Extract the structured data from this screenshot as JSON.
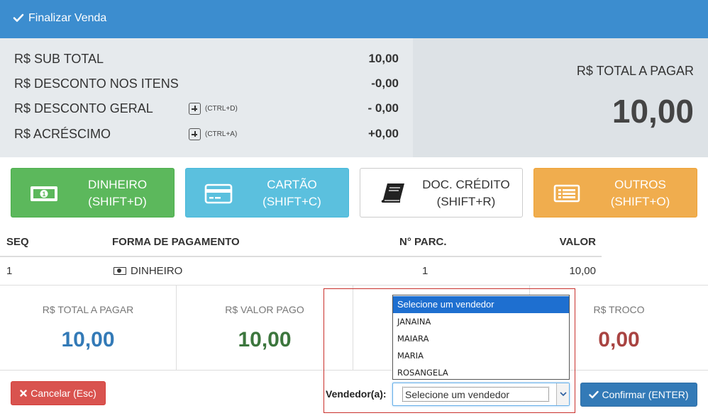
{
  "header": {
    "title": "Finalizar Venda"
  },
  "summary": {
    "rows": [
      {
        "label": "R$ SUB TOTAL",
        "value": "10,00",
        "shortcut": ""
      },
      {
        "label": "R$ DESCONTO NOS ITENS",
        "value": "-0,00",
        "shortcut": ""
      },
      {
        "label": "R$ DESCONTO GERAL",
        "value": "- 0,00",
        "shortcut": "(CTRL+D)"
      },
      {
        "label": "R$ ACRÉSCIMO",
        "value": "+0,00",
        "shortcut": "(CTRL+A)"
      }
    ],
    "total_label": "R$ TOTAL A PAGAR",
    "total_value": "10,00"
  },
  "payment_buttons": [
    {
      "label": "DINHEIRO",
      "shortcut": "(SHIFT+D)",
      "icon": "cash-icon",
      "color": "#5cb85c"
    },
    {
      "label": "CARTÃO",
      "shortcut": "(SHIFT+C)",
      "icon": "credit-card-icon",
      "color": "#5bc0de"
    },
    {
      "label": "DOC. CRÉDITO",
      "shortcut": "(SHIFT+R)",
      "icon": "book-icon",
      "color": "#ffffff"
    },
    {
      "label": "OUTROS",
      "shortcut": "(SHIFT+O)",
      "icon": "list-icon",
      "color": "#f0ad4e"
    }
  ],
  "table": {
    "headers": [
      "SEQ",
      "FORMA DE PAGAMENTO",
      "N° PARC.",
      "VALOR"
    ],
    "rows": [
      {
        "seq": "1",
        "forma": "DINHEIRO",
        "parc": "1",
        "valor": "10,00"
      }
    ]
  },
  "stats": [
    {
      "label": "R$ TOTAL A PAGAR",
      "value": "10,00",
      "color": "#337ab7"
    },
    {
      "label": "R$ VALOR PAGO",
      "value": "10,00",
      "color": "#3c763d"
    },
    {
      "label": "",
      "value": "",
      "color": "#333333"
    },
    {
      "label": "R$ TROCO",
      "value": "0,00",
      "color": "#a94442"
    }
  ],
  "footer": {
    "cancel_label": "Cancelar (Esc)",
    "confirm_label": "Confirmar (ENTER)",
    "vendor_label": "Vendedor(a):",
    "vendor_selected": "Selecione um vendedor",
    "vendor_options": [
      "Selecione um vendedor",
      "JANAINA",
      "MAIARA",
      "MARIA",
      "ROSANGELA"
    ]
  }
}
